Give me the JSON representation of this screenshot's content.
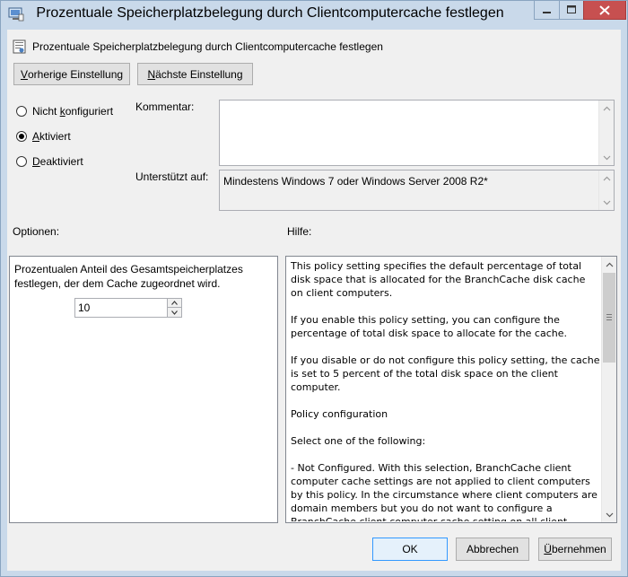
{
  "window": {
    "title": "Prozentuale Speicherplatzbelegung durch Clientcomputercache festlegen"
  },
  "header": {
    "setting_title": "Prozentuale Speicherplatzbelegung durch Clientcomputercache festlegen",
    "prev_button": {
      "pre": "",
      "key": "V",
      "post": "orherige Einstellung"
    },
    "next_button": {
      "pre": "",
      "key": "N",
      "post": "ächste Einstellung"
    }
  },
  "state": {
    "radios": [
      {
        "pre": "Nicht ",
        "key": "k",
        "post": "onfiguriert",
        "checked": false
      },
      {
        "pre": "",
        "key": "A",
        "post": "ktiviert",
        "checked": true
      },
      {
        "pre": "",
        "key": "D",
        "post": "eaktiviert",
        "checked": false
      }
    ]
  },
  "comment": {
    "label": "Kommentar:",
    "value": ""
  },
  "supported": {
    "label": "Unterstützt auf:",
    "value": "Mindestens Windows 7 oder Windows Server 2008 R2*"
  },
  "options": {
    "label": "Optionen:",
    "description": "Prozentualen Anteil des Gesamtspeicherplatzes festlegen, der dem Cache zugeordnet wird.",
    "value": "10"
  },
  "help": {
    "label": "Hilfe:",
    "paragraphs": [
      "This policy setting specifies the default percentage of total disk space that is allocated for the BranchCache disk cache on client computers.",
      "If you enable this policy setting, you can configure the percentage of total disk space to allocate for the cache.",
      "If you disable or do not configure this policy setting, the cache is set to 5 percent of the total disk space on the client computer.",
      "Policy configuration",
      "Select one of the following:",
      "- Not Configured. With this selection, BranchCache client computer cache settings are not applied to client computers by this policy. In the circumstance where client computers are domain members but you do not want to configure a BranchCache client computer cache setting on all client"
    ]
  },
  "footer": {
    "ok_label": "OK",
    "cancel_label": "Abbrechen",
    "apply_button": {
      "pre": "",
      "key": "Ü",
      "post": "bernehmen"
    }
  },
  "colors": {
    "titlebar": "#c9d9ea",
    "close_button": "#c75050",
    "dialog_bg": "#f0f0f0"
  }
}
